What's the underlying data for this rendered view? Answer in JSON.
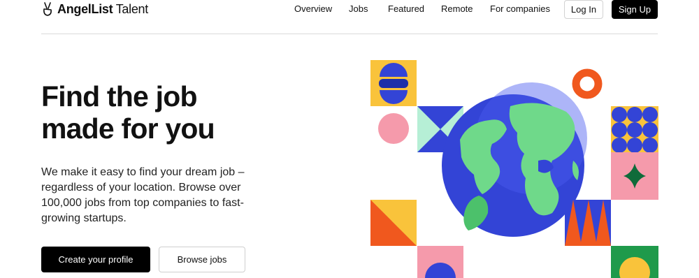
{
  "brand": {
    "name_bold": "AngelList",
    "name_regular": "Talent"
  },
  "nav": {
    "links": [
      "Overview",
      "Jobs",
      "Featured",
      "Remote",
      "For companies"
    ],
    "login_label": "Log In",
    "signup_label": "Sign Up"
  },
  "hero": {
    "title": "Find the job made for you",
    "subtitle": "We make it easy to find your dream job – regardless of your location. Browse over 100,000 jobs from top companies to fast-growing startups.",
    "primary_cta": "Create your profile",
    "secondary_cta": "Browse jobs"
  },
  "icons": {
    "logo": "victory-hand-icon"
  },
  "colors": {
    "primary": "#000000",
    "yellow": "#f9c33b",
    "blue": "#3344d6",
    "pink": "#f59aab",
    "orange": "#f0581e",
    "mint": "#b6efd6",
    "green": "#1f9a4b"
  }
}
